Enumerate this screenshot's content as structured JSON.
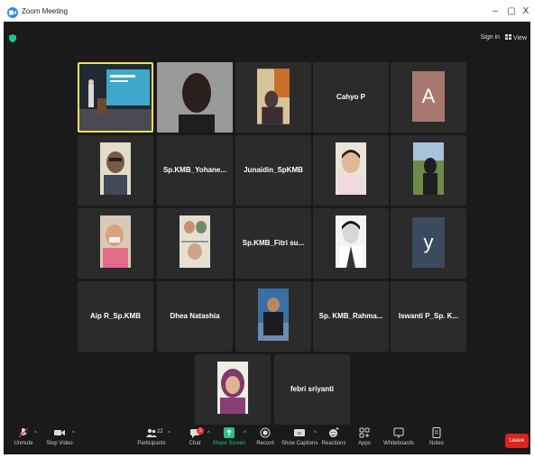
{
  "window": {
    "title": "Zoom Meeting",
    "minimize": "–",
    "restore": "▢",
    "close": "X"
  },
  "topbar": {
    "sign_in": "Sign in",
    "view": "View"
  },
  "participants": [
    {
      "name": "",
      "kind": "screen"
    },
    {
      "name": "",
      "kind": "video"
    },
    {
      "name": "",
      "kind": "video"
    },
    {
      "name": "Cahyo P",
      "kind": "name"
    },
    {
      "name": "",
      "letter": "A",
      "kind": "letter",
      "color": "#a6786e"
    },
    {
      "name": "",
      "kind": "video"
    },
    {
      "name": "Sp.KMB_Yohane...",
      "kind": "name"
    },
    {
      "name": "Junaidin_SpKMB",
      "kind": "name"
    },
    {
      "name": "",
      "kind": "video"
    },
    {
      "name": "",
      "kind": "video"
    },
    {
      "name": "",
      "kind": "video"
    },
    {
      "name": "",
      "kind": "video"
    },
    {
      "name": "Sp.KMB_Fitri su...",
      "kind": "name"
    },
    {
      "name": "",
      "kind": "video"
    },
    {
      "name": "",
      "letter": "y",
      "kind": "letter",
      "color": "#3b4a5e"
    },
    {
      "name": "Aip R_Sp.KMB",
      "kind": "name"
    },
    {
      "name": "Dhea Natashia",
      "kind": "name"
    },
    {
      "name": "",
      "kind": "video"
    },
    {
      "name": "Sp. KMB_Rahma...",
      "kind": "name"
    },
    {
      "name": "Iswanti P_Sp. K...",
      "kind": "name"
    },
    {
      "name": "",
      "kind": "video"
    },
    {
      "name": "febri sriyanti",
      "kind": "name"
    }
  ],
  "toolbar": {
    "unmute": "Unmute",
    "stop_video": "Stop Video",
    "participants": "Participants",
    "participants_count": "22",
    "chat": "Chat",
    "chat_badge": "1",
    "share_screen": "Share Screen",
    "record": "Record",
    "show_captions": "Show Captions",
    "reactions": "Reactions",
    "apps": "Apps",
    "whiteboards": "Whiteboards",
    "notes": "Notes",
    "leave": "Leave"
  },
  "colors": {
    "share_green": "#26c281",
    "leave_red": "#d9241f",
    "active_border": "#e8e35a"
  }
}
